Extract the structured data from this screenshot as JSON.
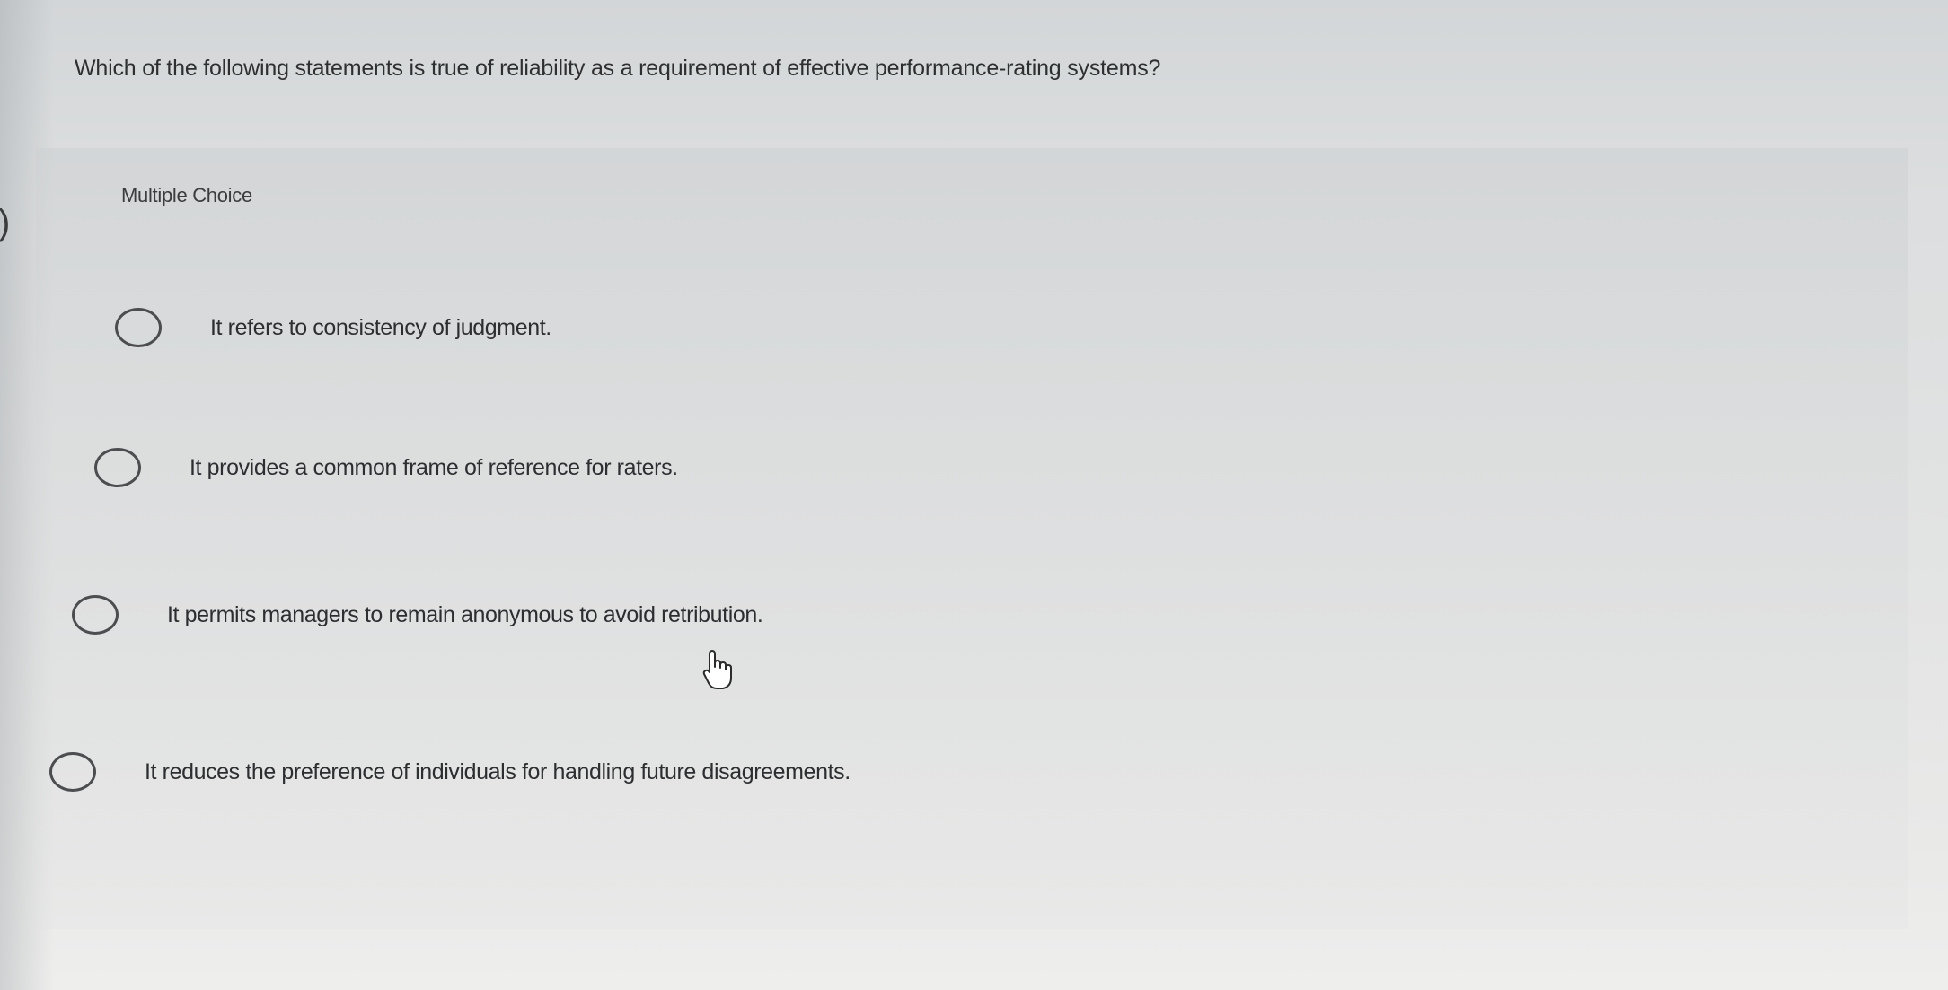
{
  "question": {
    "text": "Which of the following statements is true of reliability as a requirement of effective performance-rating systems?"
  },
  "panel": {
    "label": "Multiple Choice"
  },
  "options": [
    {
      "text": "It refers to consistency of judgment."
    },
    {
      "text": "It provides a common frame of reference for raters."
    },
    {
      "text": "It permits managers to remain anonymous to avoid retribution."
    },
    {
      "text": "It reduces the preference of individuals for handling future disagreements."
    }
  ],
  "icons": {
    "left_arrow": "chevron-left-icon",
    "cursor": "hand-pointer-icon"
  }
}
